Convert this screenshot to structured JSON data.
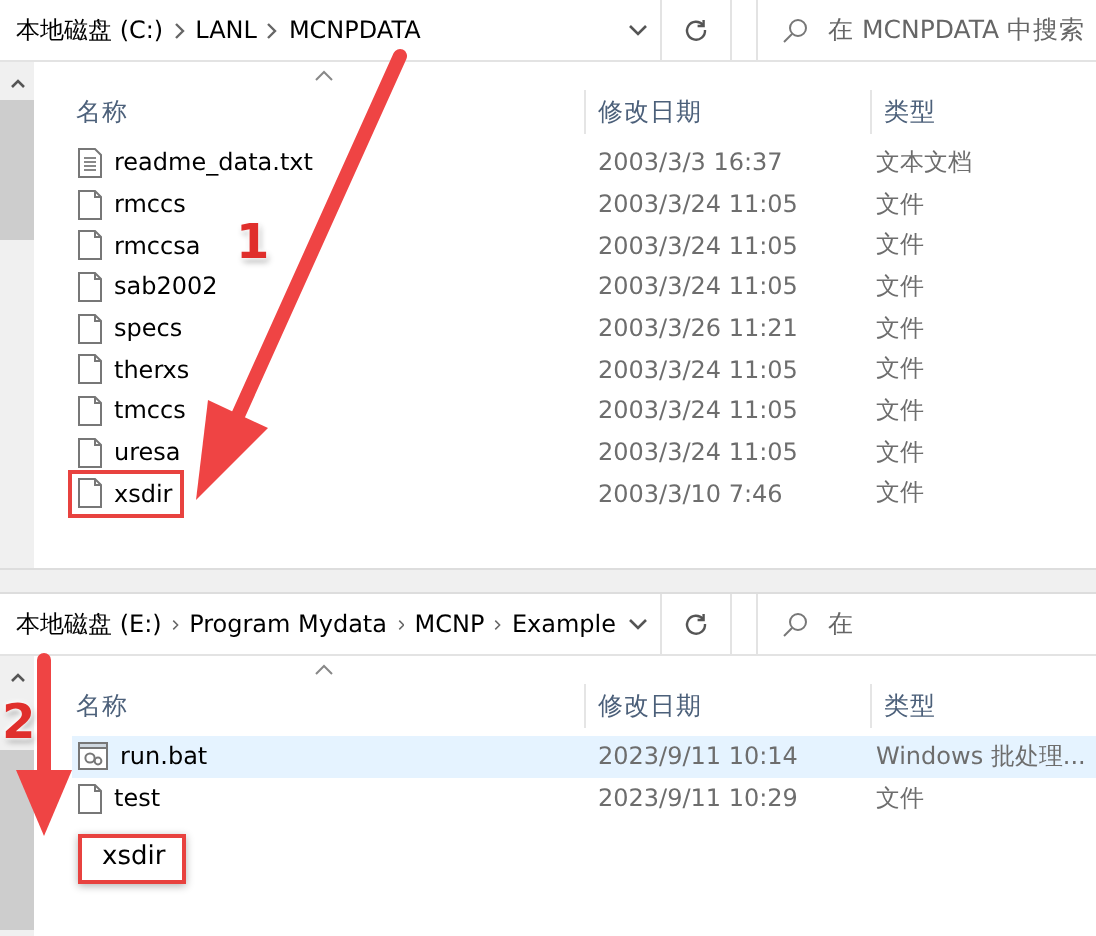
{
  "panes": [
    {
      "breadcrumb": [
        "本地磁盘 (C:)",
        "LANL",
        "MCNPDATA"
      ],
      "search": {
        "placeholder": "在 MCNPDATA 中搜索"
      },
      "columns": [
        "名称",
        "修改日期",
        "类型"
      ],
      "rows": [
        {
          "name": "readme_data.txt",
          "date": "2003/3/3 16:37",
          "type": "文本文档",
          "kind": "text",
          "selected": false,
          "boxed": false
        },
        {
          "name": "rmccs",
          "date": "2003/3/24 11:05",
          "type": "文件",
          "kind": "file",
          "selected": false,
          "boxed": false
        },
        {
          "name": "rmccsa",
          "date": "2003/3/24 11:05",
          "type": "文件",
          "kind": "file",
          "selected": false,
          "boxed": false
        },
        {
          "name": "sab2002",
          "date": "2003/3/24 11:05",
          "type": "文件",
          "kind": "file",
          "selected": false,
          "boxed": false
        },
        {
          "name": "specs",
          "date": "2003/3/26 11:21",
          "type": "文件",
          "kind": "file",
          "selected": false,
          "boxed": false
        },
        {
          "name": "therxs",
          "date": "2003/3/24 11:05",
          "type": "文件",
          "kind": "file",
          "selected": false,
          "boxed": false
        },
        {
          "name": "tmccs",
          "date": "2003/3/24 11:05",
          "type": "文件",
          "kind": "file",
          "selected": false,
          "boxed": false
        },
        {
          "name": "uresa",
          "date": "2003/3/24 11:05",
          "type": "文件",
          "kind": "file",
          "selected": false,
          "boxed": false
        },
        {
          "name": "xsdir",
          "date": "2003/3/10 7:46",
          "type": "文件",
          "kind": "file",
          "selected": false,
          "boxed": true
        }
      ]
    },
    {
      "breadcrumb": [
        "本地磁盘 (E:)",
        "Program Mydata",
        "MCNP",
        "Example"
      ],
      "search": {
        "placeholder": "在"
      },
      "columns": [
        "名称",
        "修改日期",
        "类型"
      ],
      "rows": [
        {
          "name": "run.bat",
          "date": "2023/9/11 10:14",
          "type": "Windows 批处理...",
          "kind": "batch",
          "selected": true,
          "boxed": false
        },
        {
          "name": "test",
          "date": "2023/9/11 10:29",
          "type": "文件",
          "kind": "file",
          "selected": false,
          "boxed": false
        }
      ],
      "drag_label": "xsdir"
    }
  ],
  "annotations": [
    {
      "label": "1"
    },
    {
      "label": "2"
    }
  ]
}
